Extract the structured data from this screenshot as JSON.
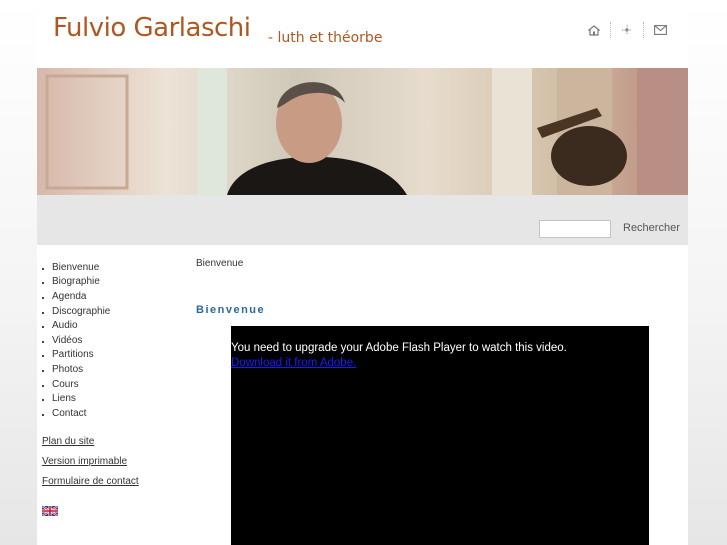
{
  "header": {
    "title": "Fulvio Garlaschi",
    "subtitle": "- luth et théorbe",
    "icons": [
      "home-icon",
      "sitemap-icon",
      "mail-icon"
    ]
  },
  "search": {
    "value": "",
    "placeholder": "",
    "button_label": "Rechercher"
  },
  "nav": {
    "items": [
      "Bienvenue",
      "Biographie",
      "Agenda",
      "Discographie",
      "Audio",
      "Vidéos",
      "Partitions",
      "Photos",
      "Cours",
      "Liens",
      "Contact"
    ]
  },
  "side_links": {
    "sitemap": "Plan du site",
    "print": "Version imprimable",
    "contact_form": "Formulaire de contact"
  },
  "language_flag": "uk-flag-icon",
  "main": {
    "breadcrumb": "Bienvenue",
    "heading": "Bienvenue",
    "flash_message": "You need to upgrade your Adobe Flash Player to watch this video.",
    "flash_link": "Download it from Adobe."
  },
  "colors": {
    "title": "#b0571f",
    "heading": "#2a6a9e",
    "search_bar": "#e6e6e6",
    "video_bg": "#000000"
  }
}
